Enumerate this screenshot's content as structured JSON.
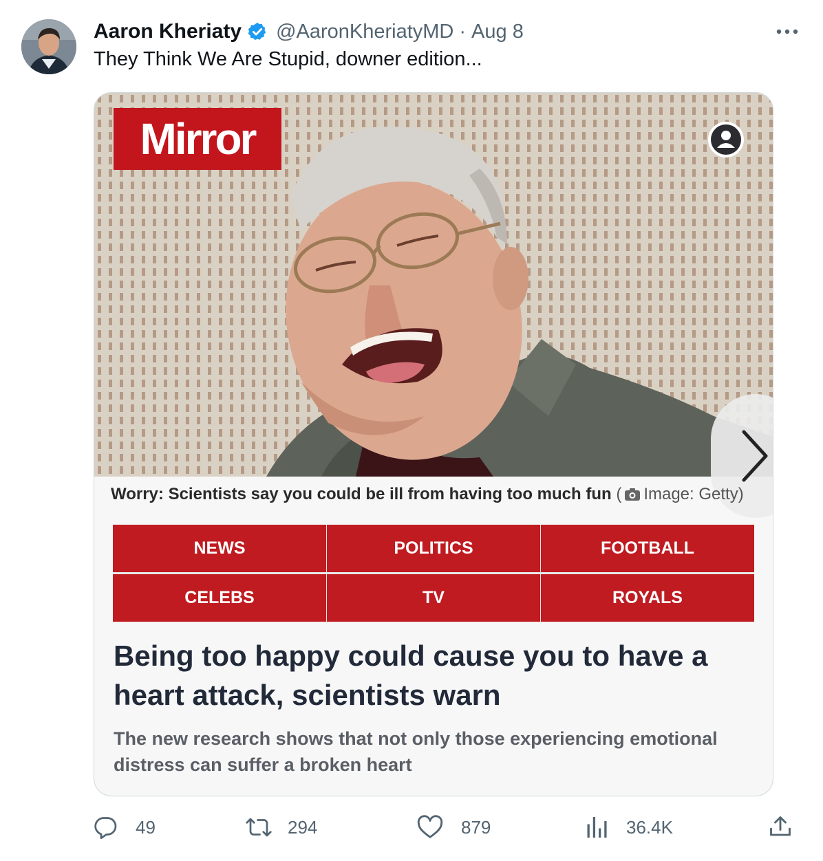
{
  "author": {
    "name": "Aaron Kheriaty",
    "handle": "@AaronKheriatyMD",
    "separator": "·",
    "date": "Aug 8",
    "verified_color": "#1d9bf0"
  },
  "tweet": {
    "text": "They Think We Are Stupid, downer edition..."
  },
  "card": {
    "logo": "Mirror",
    "caption": "Worry: Scientists say you could be ill from having too much fun",
    "caption_paren": "(",
    "image_credit": "Image: Getty)",
    "nav": [
      "NEWS",
      "POLITICS",
      "FOOTBALL",
      "CELEBS",
      "TV",
      "ROYALS"
    ],
    "headline": "Being too happy could cause you to have a heart attack, scientists warn",
    "standfirst": "The new research shows that not only those experiencing emotional distress can suffer a broken heart",
    "brand_color": "#c3151c"
  },
  "actions": {
    "replies": "49",
    "reposts": "294",
    "likes": "879",
    "views": "36.4K"
  },
  "icons": [
    "verified-badge-icon",
    "more-options-icon",
    "account-icon",
    "chevron-right-icon",
    "camera-icon",
    "reply-icon",
    "repost-icon",
    "like-icon",
    "views-icon",
    "share-icon"
  ]
}
